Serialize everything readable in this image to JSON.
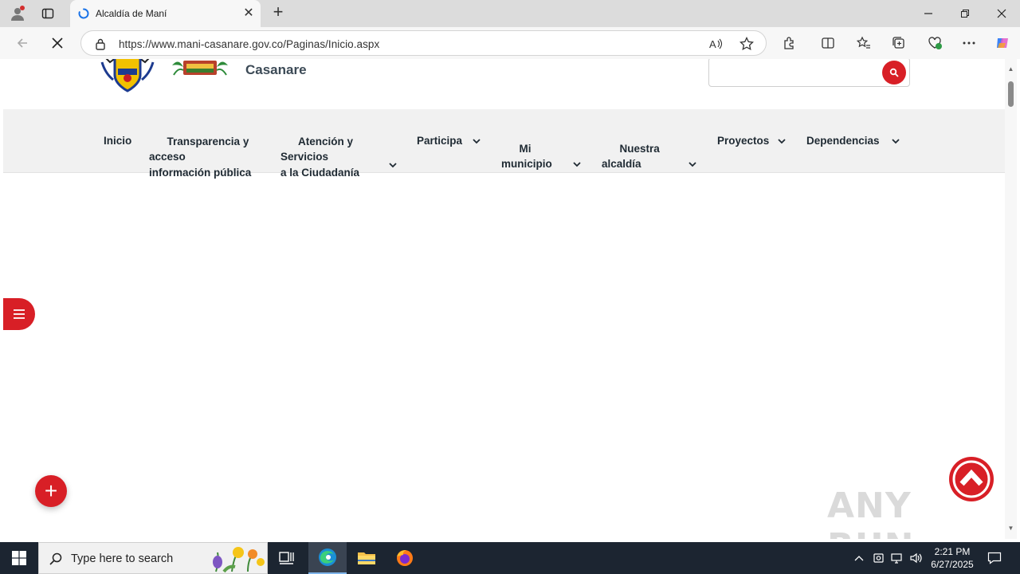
{
  "browser": {
    "tab_title": "Alcaldía de Maní",
    "url": "https://www.mani-casanare.gov.co/Paginas/Inicio.aspx"
  },
  "site": {
    "name_line": "Casanare",
    "search_placeholder": ""
  },
  "nav": {
    "items": [
      {
        "label": "Inicio"
      },
      {
        "label": "Transparencia y\nacceso\ninformación pública"
      },
      {
        "label": "Atención y\nServicios\na la Ciudadanía"
      },
      {
        "label": "Participa"
      },
      {
        "label": "Mi\nmunicipio"
      },
      {
        "label": "Nuestra\nalcaldía"
      },
      {
        "label": "Proyectos"
      },
      {
        "label": "Dependencias"
      }
    ]
  },
  "floating": {
    "plus": "+"
  },
  "watermark": "ANY RUN",
  "taskbar": {
    "search_text": "Type here to search",
    "time": "2:21 PM",
    "date": "6/27/2025"
  },
  "colors": {
    "accent": "#d81f26",
    "nav_bg": "#f1f1f1",
    "taskbar_bg": "#1c2531"
  }
}
